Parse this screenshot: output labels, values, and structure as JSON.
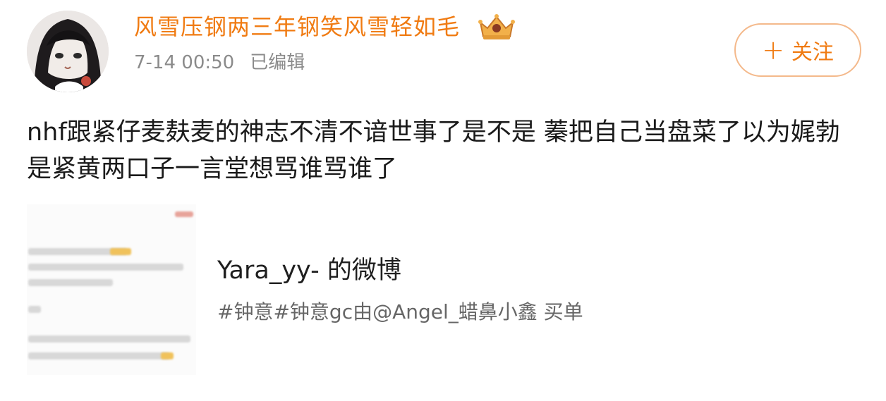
{
  "post": {
    "author": "风雪压钢两三年钢笑风雪轻如毛",
    "timestamp": "7-14 00:50",
    "edited_label": "已编辑",
    "follow_label": "关注",
    "follow_icon": "plus-icon",
    "badge_icon": "crown-badge-icon",
    "text": "nhf跟紧仔麦麸麦的神志不清不谙世事了是不是 蓁把自己当盘菜了以为娓勃是紧黄两口子一言堂想骂谁骂谁了"
  },
  "share_card": {
    "title": "Yara_yy- 的微博",
    "subtitle": "#钟意#钟意gc由@Angel_蜡鼻小鑫 买单"
  },
  "colors": {
    "accent": "#f07b12",
    "follow_border": "#f4b98b",
    "meta_gray": "#8b8b8b",
    "text": "#1a1a1a"
  }
}
